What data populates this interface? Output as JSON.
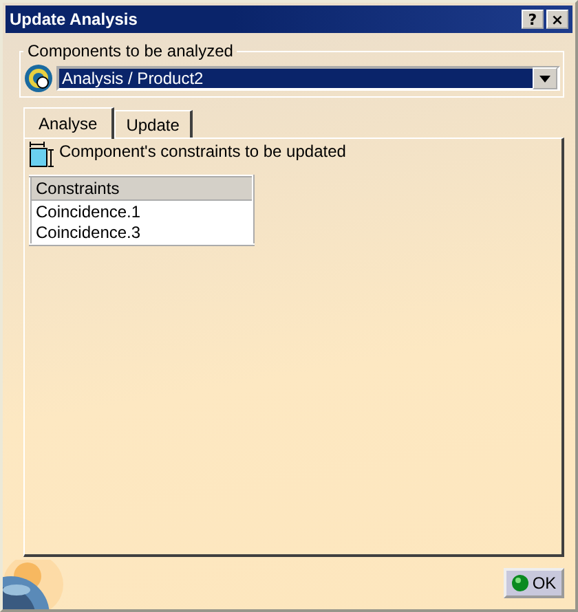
{
  "window": {
    "title": "Update Analysis",
    "buttons": [
      "?",
      "×"
    ]
  },
  "components_group": {
    "label": "Components to be analyzed",
    "value": "Analysis / Product2"
  },
  "tabs": [
    {
      "label": "Analyse",
      "selected": true
    },
    {
      "label": "Update",
      "selected": false
    }
  ],
  "constraints_section": {
    "label": "Component's constraints to be updated",
    "columns": [
      "Constraints"
    ],
    "rows": [
      "Coincidence.1",
      "Coincidence.3"
    ]
  },
  "buttons": [
    {
      "label": "OK"
    }
  ]
}
